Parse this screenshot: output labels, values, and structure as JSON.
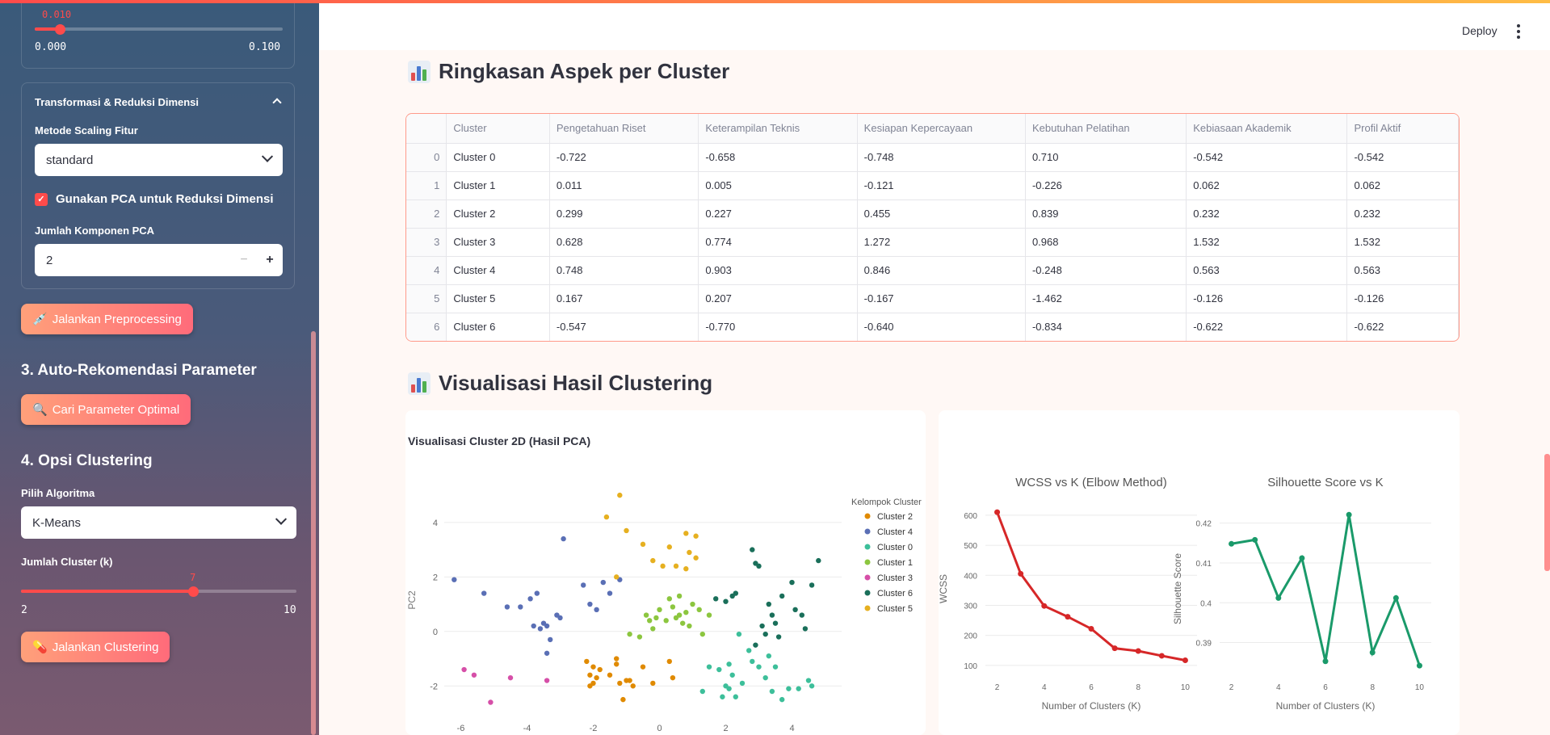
{
  "sidebar": {
    "top_slider": {
      "value": "0.010",
      "min": "0.000",
      "max": "0.100",
      "fraction": 0.1
    },
    "transform_panel": {
      "title": "Transformasi & Reduksi Dimensi",
      "scaling_label": "Metode Scaling Fitur",
      "scaling_value": "standard",
      "pca_checkbox_label": "Gunakan PCA untuk Reduksi Dimensi",
      "pca_checked": true,
      "pca_components_label": "Jumlah Komponen PCA",
      "pca_components_value": "2"
    },
    "preprocess_button": "Jalankan Preprocessing",
    "section3_title": "3. Auto-Rekomendasi Parameter",
    "search_button": "Cari Parameter Optimal",
    "section4_title": "4. Opsi Clustering",
    "algorithm_label": "Pilih Algoritma",
    "algorithm_value": "K-Means",
    "k_label": "Jumlah Cluster (k)",
    "k_slider": {
      "value": "7",
      "min": "2",
      "max": "10",
      "fraction": 0.625
    },
    "cluster_button": "Jalankan Clustering"
  },
  "header": {
    "deploy_label": "Deploy"
  },
  "summary": {
    "title": "Ringkasan Aspek per Cluster",
    "columns": [
      "",
      "Cluster",
      "Pengetahuan Riset",
      "Keterampilan Teknis",
      "Kesiapan Kepercayaan",
      "Kebutuhan Pelatihan",
      "Kebiasaan Akademik",
      "Profil Aktif"
    ],
    "rows": [
      [
        "0",
        "Cluster 0",
        "-0.722",
        "-0.658",
        "-0.748",
        "0.710",
        "-0.542",
        "-0.542"
      ],
      [
        "1",
        "Cluster 1",
        "0.011",
        "0.005",
        "-0.121",
        "-0.226",
        "0.062",
        "0.062"
      ],
      [
        "2",
        "Cluster 2",
        "0.299",
        "0.227",
        "0.455",
        "0.839",
        "0.232",
        "0.232"
      ],
      [
        "3",
        "Cluster 3",
        "0.628",
        "0.774",
        "1.272",
        "0.968",
        "1.532",
        "1.532"
      ],
      [
        "4",
        "Cluster 4",
        "0.748",
        "0.903",
        "0.846",
        "-0.248",
        "0.563",
        "0.563"
      ],
      [
        "5",
        "Cluster 5",
        "0.167",
        "0.207",
        "-0.167",
        "-1.462",
        "-0.126",
        "-0.126"
      ],
      [
        "6",
        "Cluster 6",
        "-0.547",
        "-0.770",
        "-0.640",
        "-0.834",
        "-0.622",
        "-0.622"
      ]
    ]
  },
  "viz": {
    "title": "Visualisasi Hasil Clustering"
  },
  "chart_data": [
    {
      "type": "scatter",
      "title": "Visualisasi Cluster 2D (Hasil PCA)",
      "xlabel": "",
      "ylabel": "PC2",
      "xlim": [
        -6.5,
        5.5
      ],
      "ylim": [
        -3.0,
        5.3
      ],
      "xticks": [
        -6,
        -4,
        -2,
        0,
        2,
        4
      ],
      "yticks": [
        -2,
        0,
        2,
        4
      ],
      "legend_title": "Kelompok Cluster",
      "legend_position": "right",
      "series": [
        {
          "name": "Cluster 2",
          "color": "#e08a00",
          "points": [
            [
              -2.2,
              -1.1
            ],
            [
              -2.0,
              -1.3
            ],
            [
              -2.0,
              -1.9
            ],
            [
              -2.1,
              -2.0
            ],
            [
              -1.9,
              -1.7
            ],
            [
              -1.8,
              -1.4
            ],
            [
              -1.5,
              -1.6
            ],
            [
              -1.3,
              -1.2
            ],
            [
              -1.2,
              -1.9
            ],
            [
              -1.0,
              -1.8
            ],
            [
              -0.9,
              -1.8
            ],
            [
              -0.8,
              -2.0
            ],
            [
              -1.1,
              -2.5
            ],
            [
              -0.5,
              -1.3
            ],
            [
              -0.2,
              -1.9
            ],
            [
              0.3,
              -1.1
            ],
            [
              0.4,
              -1.7
            ],
            [
              -1.3,
              -1.0
            ],
            [
              -2.1,
              -1.6
            ]
          ]
        },
        {
          "name": "Cluster 4",
          "color": "#5a6fb5",
          "points": [
            [
              -6.2,
              1.9
            ],
            [
              -5.3,
              1.4
            ],
            [
              -4.6,
              0.9
            ],
            [
              -4.2,
              0.9
            ],
            [
              -3.9,
              1.2
            ],
            [
              -3.8,
              0.2
            ],
            [
              -3.6,
              0.1
            ],
            [
              -3.5,
              0.3
            ],
            [
              -3.4,
              0.2
            ],
            [
              -3.3,
              -0.3
            ],
            [
              -3.1,
              0.6
            ],
            [
              -3.0,
              0.5
            ],
            [
              -2.9,
              3.4
            ],
            [
              -3.4,
              -0.8
            ],
            [
              -2.3,
              1.7
            ],
            [
              -2.1,
              1.0
            ],
            [
              -1.9,
              0.8
            ],
            [
              -1.7,
              1.8
            ],
            [
              -1.5,
              1.4
            ],
            [
              -1.2,
              1.9
            ],
            [
              -3.7,
              1.4
            ]
          ]
        },
        {
          "name": "Cluster 0",
          "color": "#3dbf9a",
          "points": [
            [
              1.3,
              -2.2
            ],
            [
              1.5,
              -1.3
            ],
            [
              1.8,
              -1.4
            ],
            [
              1.9,
              -2.4
            ],
            [
              2.0,
              -2.0
            ],
            [
              2.1,
              -2.1
            ],
            [
              2.2,
              -1.6
            ],
            [
              2.1,
              -1.2
            ],
            [
              2.5,
              -1.9
            ],
            [
              2.7,
              -0.7
            ],
            [
              2.8,
              -1.1
            ],
            [
              3.0,
              -1.3
            ],
            [
              3.2,
              -1.7
            ],
            [
              3.3,
              -0.9
            ],
            [
              3.4,
              -2.2
            ],
            [
              3.7,
              -2.5
            ],
            [
              3.9,
              -2.1
            ],
            [
              4.2,
              -2.1
            ],
            [
              4.5,
              -1.8
            ],
            [
              4.6,
              -2.0
            ],
            [
              3.5,
              -1.3
            ],
            [
              2.4,
              -0.1
            ],
            [
              2.3,
              -2.4
            ]
          ]
        },
        {
          "name": "Cluster 1",
          "color": "#8cc63f",
          "points": [
            [
              -0.9,
              -0.1
            ],
            [
              -0.6,
              -0.2
            ],
            [
              -0.4,
              0.6
            ],
            [
              -0.3,
              0.4
            ],
            [
              -0.2,
              0.1
            ],
            [
              0.0,
              0.8
            ],
            [
              0.2,
              0.4
            ],
            [
              0.3,
              1.2
            ],
            [
              0.4,
              0.9
            ],
            [
              0.5,
              0.5
            ],
            [
              0.6,
              0.6
            ],
            [
              0.7,
              0.3
            ],
            [
              0.8,
              0.7
            ],
            [
              0.9,
              0.2
            ],
            [
              1.0,
              1.0
            ],
            [
              1.2,
              0.8
            ],
            [
              1.3,
              -0.1
            ],
            [
              -0.1,
              0.5
            ],
            [
              0.6,
              1.3
            ],
            [
              1.5,
              0.6
            ]
          ]
        },
        {
          "name": "Cluster 3",
          "color": "#d64fa8",
          "points": [
            [
              -5.9,
              -1.4
            ],
            [
              -5.6,
              -1.6
            ],
            [
              -5.1,
              -2.6
            ],
            [
              -4.5,
              -1.7
            ],
            [
              -3.4,
              -1.8
            ]
          ]
        },
        {
          "name": "Cluster 6",
          "color": "#1a6f5a",
          "points": [
            [
              1.7,
              1.2
            ],
            [
              2.0,
              1.1
            ],
            [
              2.2,
              1.3
            ],
            [
              2.3,
              1.4
            ],
            [
              2.8,
              3.0
            ],
            [
              2.9,
              2.5
            ],
            [
              3.0,
              2.4
            ],
            [
              3.1,
              0.2
            ],
            [
              3.2,
              -0.1
            ],
            [
              3.3,
              1.0
            ],
            [
              3.4,
              0.6
            ],
            [
              3.5,
              0.3
            ],
            [
              3.6,
              -0.2
            ],
            [
              3.7,
              1.3
            ],
            [
              4.0,
              1.8
            ],
            [
              4.1,
              0.8
            ],
            [
              4.3,
              0.6
            ],
            [
              4.4,
              0.1
            ],
            [
              4.6,
              1.7
            ],
            [
              4.8,
              2.6
            ],
            [
              2.9,
              -0.5
            ]
          ]
        },
        {
          "name": "Cluster 5",
          "color": "#e6b020",
          "points": [
            [
              -1.2,
              5.0
            ],
            [
              -1.6,
              4.2
            ],
            [
              -1.0,
              3.7
            ],
            [
              -0.5,
              3.2
            ],
            [
              -0.2,
              2.6
            ],
            [
              0.1,
              2.4
            ],
            [
              0.3,
              3.1
            ],
            [
              0.8,
              3.6
            ],
            [
              0.9,
              2.9
            ],
            [
              1.1,
              2.7
            ],
            [
              -1.3,
              2.0
            ],
            [
              0.8,
              2.3
            ],
            [
              1.1,
              3.5
            ],
            [
              0.5,
              2.4
            ]
          ]
        }
      ]
    },
    {
      "type": "line",
      "title": "WCSS vs K (Elbow Method)",
      "xlabel": "Number of Clusters (K)",
      "ylabel": "WCSS",
      "color": "#d62728",
      "xlim": [
        1.5,
        10.5
      ],
      "ylim": [
        70,
        640
      ],
      "xticks": [
        2,
        4,
        6,
        8,
        10
      ],
      "yticks": [
        100,
        200,
        300,
        400,
        500,
        600
      ],
      "x": [
        2,
        3,
        4,
        5,
        6,
        7,
        8,
        9,
        10
      ],
      "y": [
        610,
        405,
        298,
        262,
        222,
        157,
        148,
        132,
        117
      ]
    },
    {
      "type": "line",
      "title": "Silhouette Score vs K",
      "xlabel": "Number of Clusters (K)",
      "ylabel": "Silhouette Score",
      "color": "#1a9a6a",
      "xlim": [
        1.5,
        10.5
      ],
      "ylim": [
        0.382,
        0.425
      ],
      "xticks": [
        2,
        4,
        6,
        8,
        10
      ],
      "yticks": [
        0.39,
        0.4,
        0.41,
        0.42
      ],
      "x": [
        2,
        3,
        4,
        5,
        6,
        7,
        8,
        9,
        10
      ],
      "y": [
        0.4148,
        0.4158,
        0.4012,
        0.4112,
        0.3853,
        0.4221,
        0.3875,
        0.4012,
        0.3842
      ]
    }
  ]
}
